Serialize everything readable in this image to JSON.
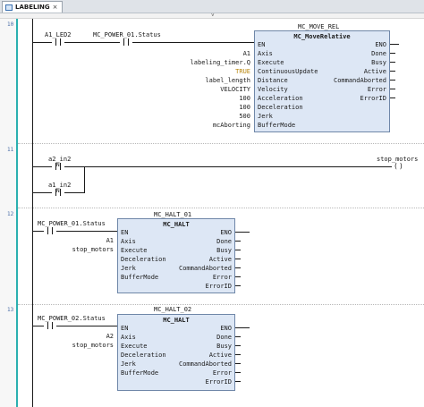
{
  "tab": {
    "label": "LABELING",
    "close": "×"
  },
  "splitter": "˅",
  "rungs": {
    "r1": {
      "number": "10",
      "contacts": [
        {
          "name": "A1_LED2"
        },
        {
          "name": "MC_POWER_01.Status"
        }
      ],
      "fb": {
        "instance": "MC_MOVE_REL",
        "type": "MC_MoveRelative",
        "inputs": [
          {
            "pin": "EN",
            "arg": ""
          },
          {
            "pin": "Axis",
            "arg": "A1"
          },
          {
            "pin": "Execute",
            "arg": "labeling_timer.Q"
          },
          {
            "pin": "ContinuousUpdate",
            "arg": "TRUE"
          },
          {
            "pin": "Distance",
            "arg": "label_length"
          },
          {
            "pin": "Velocity",
            "arg": "VELOCITY"
          },
          {
            "pin": "Acceleration",
            "arg": "100"
          },
          {
            "pin": "Deceleration",
            "arg": "100"
          },
          {
            "pin": "Jerk",
            "arg": "500"
          },
          {
            "pin": "BufferMode",
            "arg": "mcAborting"
          }
        ],
        "outputs": [
          "ENO",
          "Done",
          "Busy",
          "Active",
          "CommandAborted",
          "Error",
          "ErrorID"
        ]
      }
    },
    "r2": {
      "number": "11",
      "contacts": [
        {
          "name": "a2_in2",
          "flag": "N"
        },
        {
          "name": "a1_in2",
          "flag": "N"
        }
      ],
      "coil": "stop_motors"
    },
    "r3": {
      "number": "12",
      "contact": {
        "name": "MC_POWER_01.Status"
      },
      "fb": {
        "instance": "MC_HALT_01",
        "type": "MC_HALT",
        "inputs": [
          {
            "pin": "EN",
            "arg": ""
          },
          {
            "pin": "Axis",
            "arg": "A1"
          },
          {
            "pin": "Execute",
            "arg": "stop_motors"
          },
          {
            "pin": "Deceleration",
            "arg": ""
          },
          {
            "pin": "Jerk",
            "arg": ""
          },
          {
            "pin": "BufferMode",
            "arg": ""
          }
        ],
        "outputs": [
          "ENO",
          "Done",
          "Busy",
          "Active",
          "CommandAborted",
          "Error",
          "ErrorID"
        ]
      }
    },
    "r4": {
      "number": "13",
      "contact": {
        "name": "MC_POWER_02.Status"
      },
      "fb": {
        "instance": "MC_HALT_02",
        "type": "MC_HALT",
        "inputs": [
          {
            "pin": "EN",
            "arg": ""
          },
          {
            "pin": "Axis",
            "arg": "A2"
          },
          {
            "pin": "Execute",
            "arg": "stop_motors"
          },
          {
            "pin": "Deceleration",
            "arg": ""
          },
          {
            "pin": "Jerk",
            "arg": ""
          },
          {
            "pin": "BufferMode",
            "arg": ""
          }
        ],
        "outputs": [
          "ENO",
          "Done",
          "Busy",
          "Active",
          "CommandAborted",
          "Error",
          "ErrorID"
        ]
      }
    }
  },
  "colors": {
    "rail": "#2bb0b0",
    "fb_fill": "#dde7f5",
    "fb_border": "#6f87a8",
    "true_const": "#b8860b"
  }
}
